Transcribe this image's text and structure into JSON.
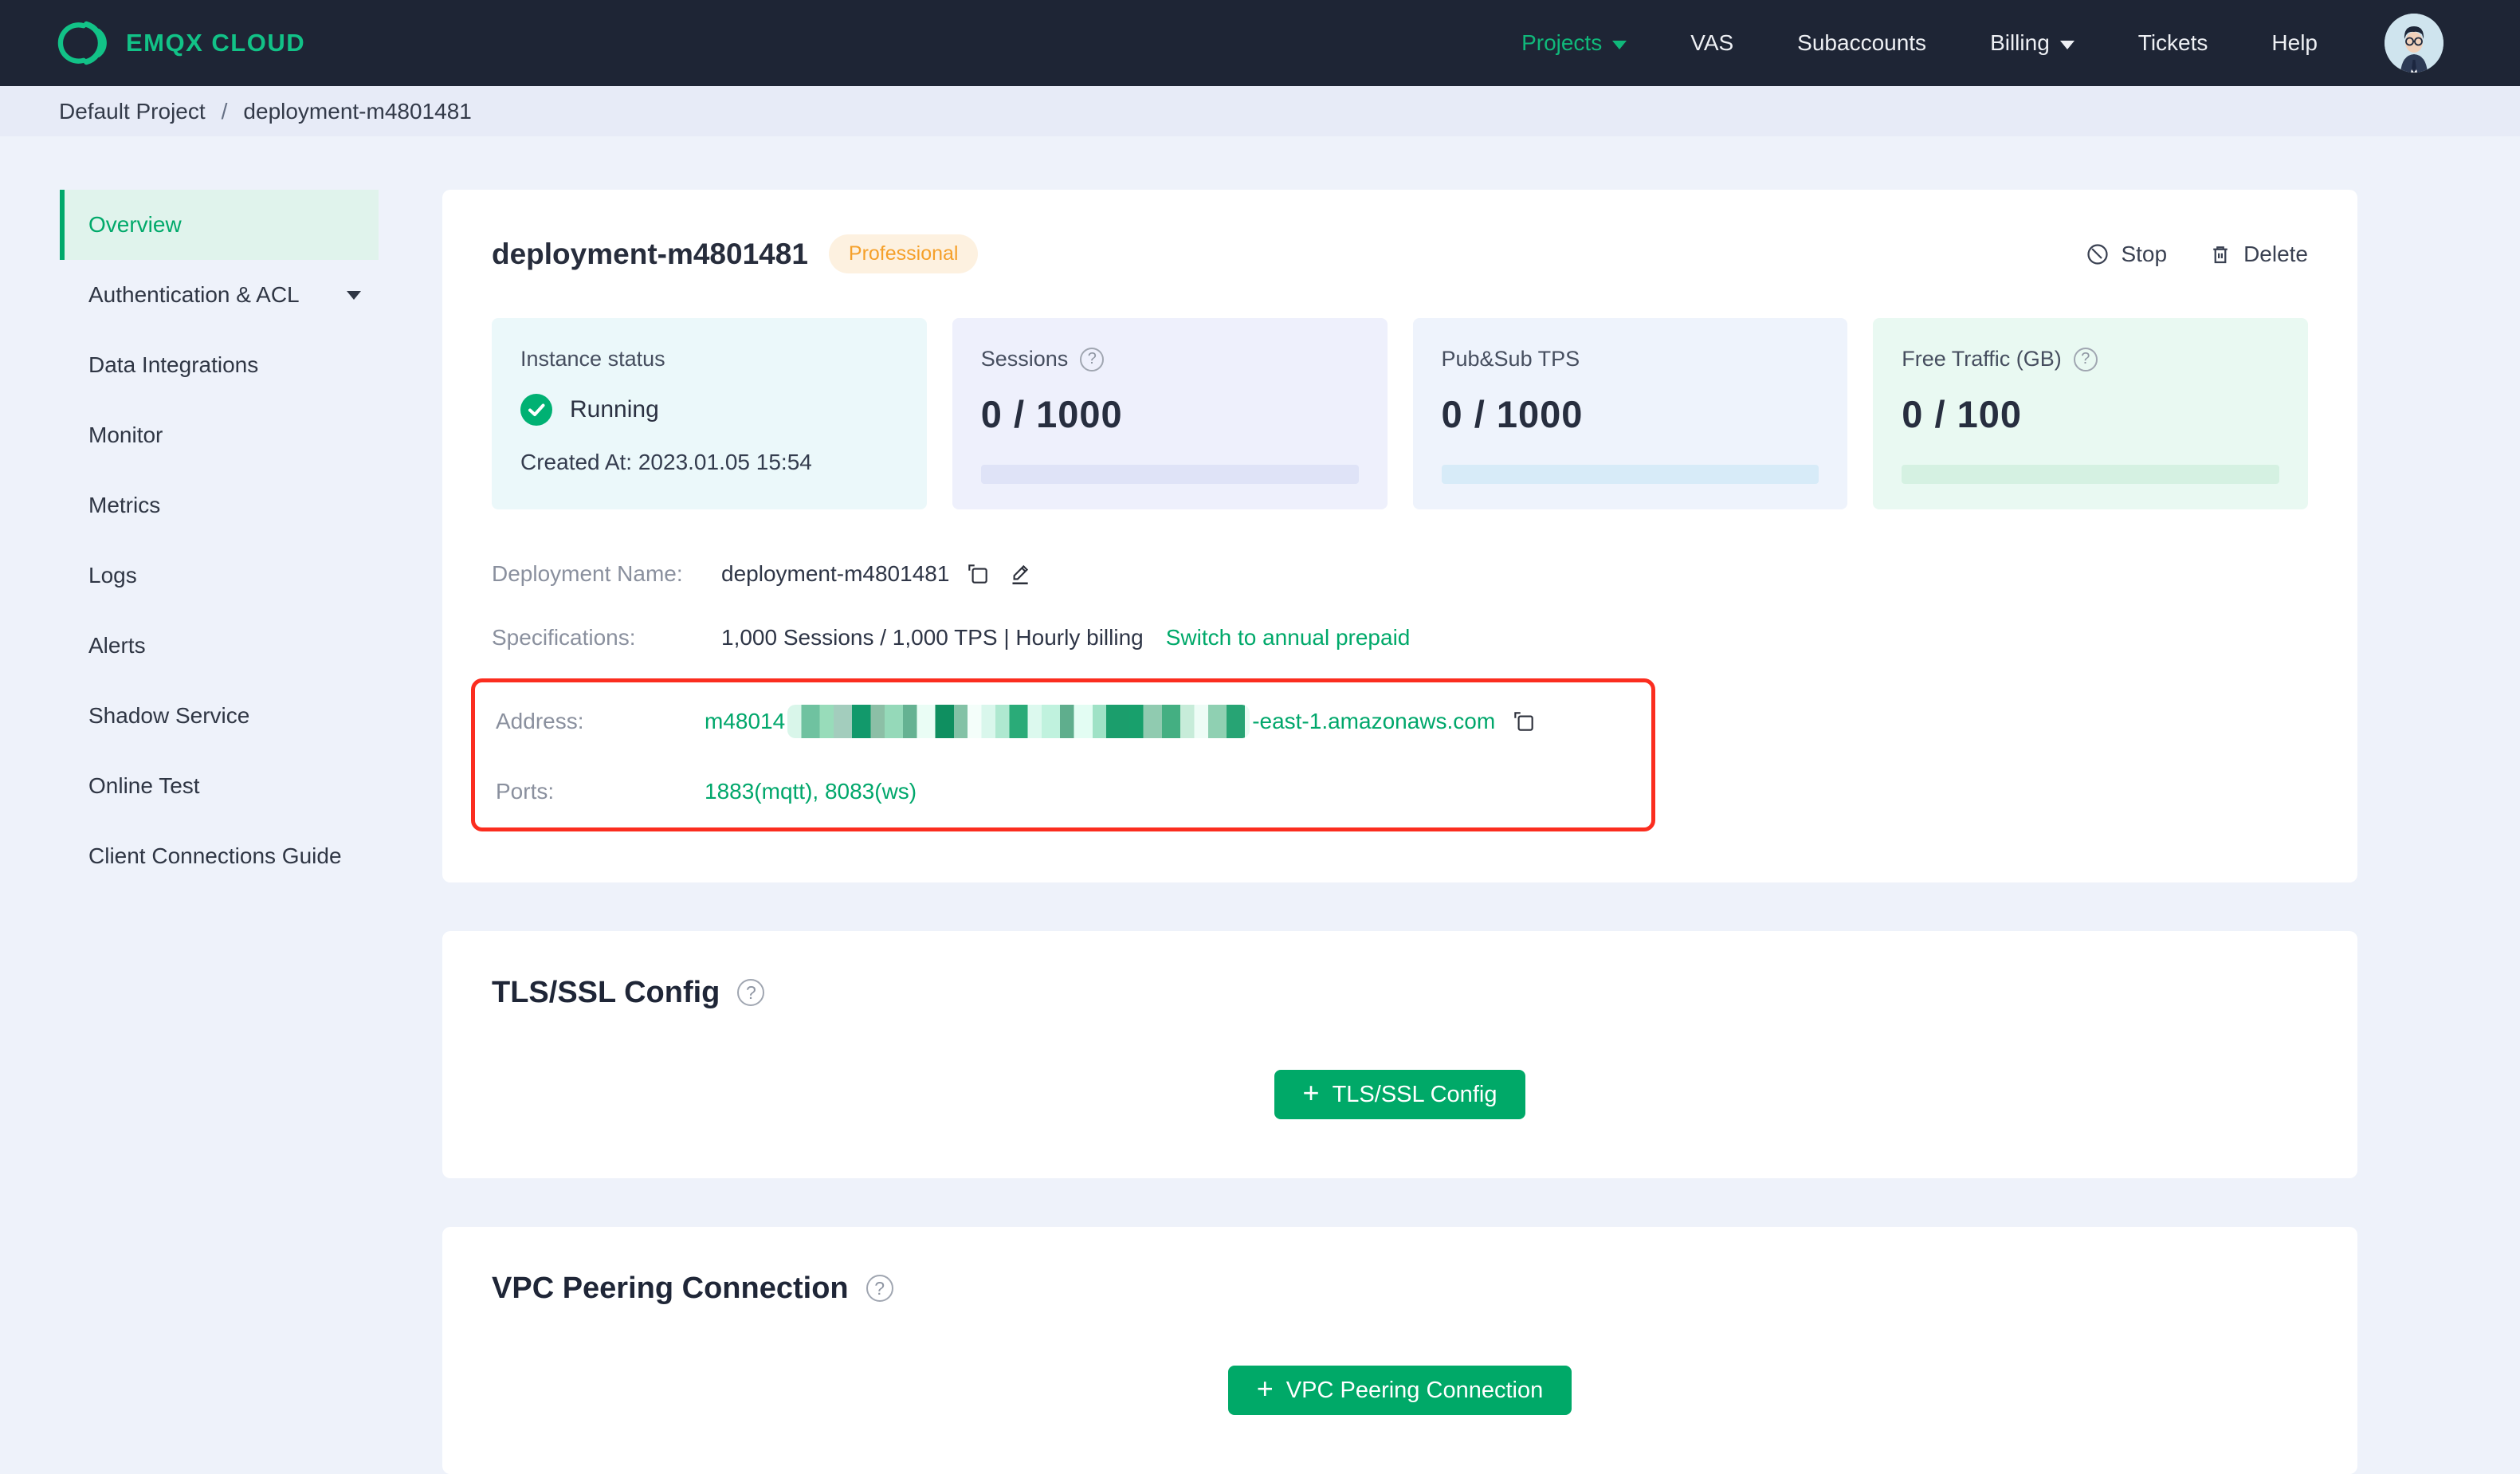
{
  "navbar": {
    "brand": "EMQX CLOUD",
    "items": [
      {
        "label": "Projects",
        "icon": "chevron-down",
        "active": true
      },
      {
        "label": "VAS"
      },
      {
        "label": "Subaccounts"
      },
      {
        "label": "Billing",
        "icon": "chevron-down"
      },
      {
        "label": "Tickets"
      },
      {
        "label": "Help"
      }
    ],
    "avatar_icon": "user-avatar"
  },
  "breadcrumb": {
    "project": "Default Project",
    "separator": "/",
    "current": "deployment-m4801481"
  },
  "sidebar": {
    "items": [
      {
        "label": "Overview",
        "active": true
      },
      {
        "label": "Authentication & ACL",
        "icon": "chevron-down"
      },
      {
        "label": "Data Integrations"
      },
      {
        "label": "Monitor"
      },
      {
        "label": "Metrics"
      },
      {
        "label": "Logs"
      },
      {
        "label": "Alerts"
      },
      {
        "label": "Shadow Service"
      },
      {
        "label": "Online Test"
      },
      {
        "label": "Client Connections Guide"
      }
    ]
  },
  "overview": {
    "title": "deployment-m4801481",
    "badge": "Professional",
    "stop_label": "Stop",
    "delete_label": "Delete",
    "stats": {
      "instance": {
        "label": "Instance status",
        "status": "Running",
        "created_at": "Created At: 2023.01.05 15:54",
        "status_icon": "check-circle"
      },
      "sessions": {
        "label": "Sessions",
        "value": "0 / 1000",
        "help_icon": "question-circle"
      },
      "tps": {
        "label": "Pub&Sub TPS",
        "value": "0 / 1000"
      },
      "traffic": {
        "label": "Free Traffic (GB)",
        "value": "0 / 100",
        "help_icon": "question-circle"
      }
    },
    "details": {
      "name_label": "Deployment Name:",
      "name_value": "deployment-m4801481",
      "spec_label": "Specifications:",
      "spec_value": "1,000 Sessions / 1,000 TPS | Hourly billing",
      "spec_link": "Switch to annual prepaid",
      "address_label": "Address:",
      "address_prefix": "m48014",
      "address_redacted": true,
      "address_suffix": "-east-1.amazonaws.com",
      "ports_label": "Ports:",
      "ports_value": "1883(mqtt), 8083(ws)"
    }
  },
  "tls": {
    "title": "TLS/SSL Config",
    "button_label": "TLS/SSL Config",
    "button_icon": "plus"
  },
  "vpc": {
    "title": "VPC Peering Connection",
    "button_label": "VPC Peering Connection",
    "button_icon": "plus"
  },
  "colors": {
    "navbar_bg": "#1e2535",
    "brand_green": "#12c287",
    "accent_green": "#00a96a",
    "status_green": "#00b173",
    "badge_text": "#f5a02a",
    "badge_bg": "#fdf1e0",
    "annotation_red": "#fb2d1f",
    "page_bg": "#eef2fa",
    "breadcrumb_bg": "#e7ebf7"
  }
}
